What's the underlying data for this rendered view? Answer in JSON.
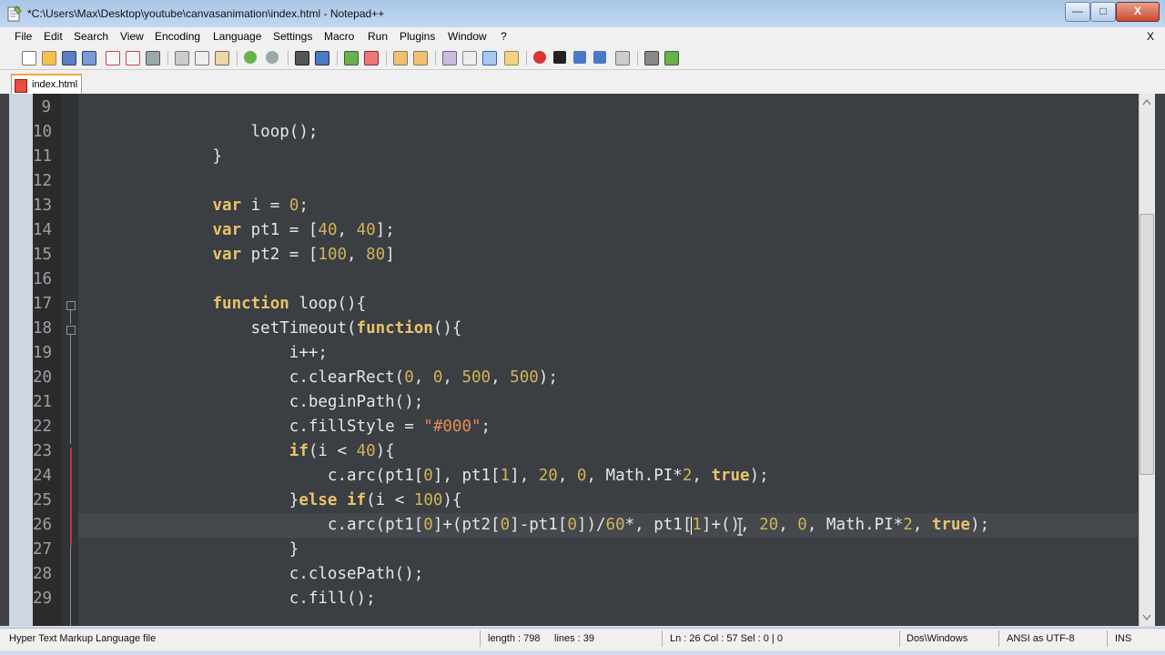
{
  "window": {
    "title": "*C:\\Users\\Max\\Desktop\\youtube\\canvasanimation\\index.html - Notepad++",
    "min": "—",
    "max": "□",
    "close": "X"
  },
  "menu": [
    "File",
    "Edit",
    "Search",
    "View",
    "Encoding",
    "Language",
    "Settings",
    "Macro",
    "Run",
    "Plugins",
    "Window",
    "?"
  ],
  "menu_close": "X",
  "tab": {
    "label": "index.html"
  },
  "editor": {
    "lines": [
      {
        "n": "9",
        "code": []
      },
      {
        "n": "10",
        "code": [
          [
            "t-p",
            "                  loop();"
          ]
        ]
      },
      {
        "n": "11",
        "code": [
          [
            "t-p",
            "              }"
          ]
        ]
      },
      {
        "n": "12",
        "code": []
      },
      {
        "n": "13",
        "code": [
          [
            "t-p",
            "              "
          ],
          [
            "t-kw",
            "var"
          ],
          [
            "t-p",
            " i = "
          ],
          [
            "t-num",
            "0"
          ],
          [
            "t-p",
            ";"
          ]
        ]
      },
      {
        "n": "14",
        "code": [
          [
            "t-p",
            "              "
          ],
          [
            "t-kw",
            "var"
          ],
          [
            "t-p",
            " pt1 = ["
          ],
          [
            "t-num",
            "40"
          ],
          [
            "t-p",
            ", "
          ],
          [
            "t-num",
            "40"
          ],
          [
            "t-p",
            "];"
          ]
        ]
      },
      {
        "n": "15",
        "code": [
          [
            "t-p",
            "              "
          ],
          [
            "t-kw",
            "var"
          ],
          [
            "t-p",
            " pt2 = ["
          ],
          [
            "t-num",
            "100"
          ],
          [
            "t-p",
            ", "
          ],
          [
            "t-num",
            "80"
          ],
          [
            "t-p",
            "]"
          ]
        ]
      },
      {
        "n": "16",
        "code": []
      },
      {
        "n": "17",
        "code": [
          [
            "t-p",
            "              "
          ],
          [
            "t-kw",
            "function"
          ],
          [
            "t-p",
            " loop(){"
          ]
        ]
      },
      {
        "n": "18",
        "code": [
          [
            "t-p",
            "                  setTimeout("
          ],
          [
            "t-kw",
            "function"
          ],
          [
            "t-p",
            "(){"
          ]
        ]
      },
      {
        "n": "19",
        "code": [
          [
            "t-p",
            "                      i++;"
          ]
        ]
      },
      {
        "n": "20",
        "code": [
          [
            "t-p",
            "                      c.clearRect("
          ],
          [
            "t-num",
            "0"
          ],
          [
            "t-p",
            ", "
          ],
          [
            "t-num",
            "0"
          ],
          [
            "t-p",
            ", "
          ],
          [
            "t-num",
            "500"
          ],
          [
            "t-p",
            ", "
          ],
          [
            "t-num",
            "500"
          ],
          [
            "t-p",
            ");"
          ]
        ]
      },
      {
        "n": "21",
        "code": [
          [
            "t-p",
            "                      c.beginPath();"
          ]
        ]
      },
      {
        "n": "22",
        "code": [
          [
            "t-p",
            "                      c.fillStyle = "
          ],
          [
            "t-str",
            "\"#000\""
          ],
          [
            "t-p",
            ";"
          ]
        ]
      },
      {
        "n": "23",
        "code": [
          [
            "t-p",
            "                      "
          ],
          [
            "t-kw",
            "if"
          ],
          [
            "t-p",
            "(i < "
          ],
          [
            "t-num",
            "40"
          ],
          [
            "t-p",
            "){"
          ]
        ]
      },
      {
        "n": "24",
        "code": [
          [
            "t-p",
            "                          c.arc(pt1["
          ],
          [
            "t-num",
            "0"
          ],
          [
            "t-p",
            "], pt1["
          ],
          [
            "t-num",
            "1"
          ],
          [
            "t-p",
            "], "
          ],
          [
            "t-num",
            "20"
          ],
          [
            "t-p",
            ", "
          ],
          [
            "t-num",
            "0"
          ],
          [
            "t-p",
            ", Math.PI*"
          ],
          [
            "t-num",
            "2"
          ],
          [
            "t-p",
            ", "
          ],
          [
            "t-kw",
            "true"
          ],
          [
            "t-p",
            ");"
          ]
        ]
      },
      {
        "n": "25",
        "code": [
          [
            "t-p",
            "                      }"
          ],
          [
            "t-kw",
            "else if"
          ],
          [
            "t-p",
            "(i < "
          ],
          [
            "t-num",
            "100"
          ],
          [
            "t-p",
            "){"
          ]
        ]
      },
      {
        "n": "26",
        "code": [
          [
            "t-p",
            "                          c.arc(pt1["
          ],
          [
            "t-num",
            "0"
          ],
          [
            "t-p",
            "]+(pt2["
          ],
          [
            "t-num",
            "0"
          ],
          [
            "t-p",
            "]-pt1["
          ],
          [
            "t-num",
            "0"
          ],
          [
            "t-p",
            "])/"
          ],
          [
            "t-num",
            "60"
          ],
          [
            "t-p",
            "*, pt1["
          ],
          [
            "t-num",
            "1"
          ],
          [
            "t-p",
            "]+(), "
          ],
          [
            "t-num",
            "20"
          ],
          [
            "t-p",
            ", "
          ],
          [
            "t-num",
            "0"
          ],
          [
            "t-p",
            ", Math.PI*"
          ],
          [
            "t-num",
            "2"
          ],
          [
            "t-p",
            ", "
          ],
          [
            "t-kw",
            "true"
          ],
          [
            "t-p",
            ");"
          ]
        ]
      },
      {
        "n": "27",
        "code": [
          [
            "t-p",
            "                      }"
          ]
        ]
      },
      {
        "n": "28",
        "code": [
          [
            "t-p",
            "                      c.closePath();"
          ]
        ]
      },
      {
        "n": "29",
        "code": [
          [
            "t-p",
            "                      c.fill();"
          ]
        ]
      }
    ]
  },
  "status": {
    "filetype": "Hyper Text Markup Language file",
    "length": "length : 798",
    "lines": "lines : 39",
    "pos": "Ln : 26    Col : 57    Sel : 0 | 0",
    "eol": "Dos\\Windows",
    "encoding": "ANSI as UTF-8",
    "mode": "INS"
  },
  "colors": {
    "keyword": "#e9c46a",
    "number": "#d0b45a",
    "string": "#e78a5b",
    "text": "#e6e6e6",
    "background": "#3b3e42"
  }
}
